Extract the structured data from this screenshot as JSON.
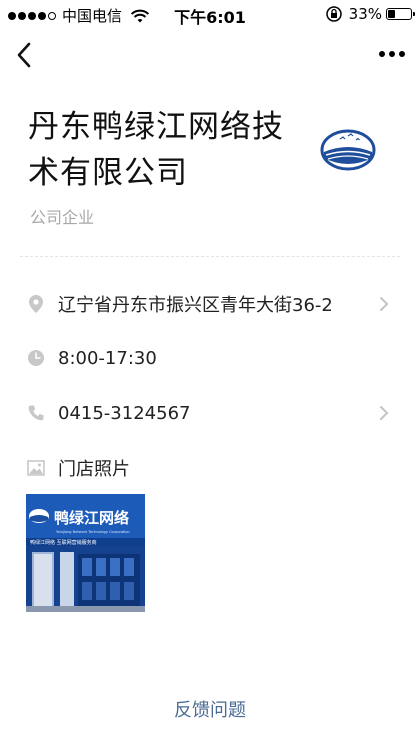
{
  "status_bar": {
    "carrier": "中国电信",
    "time": "下午6:01",
    "battery_percent_label": "33%",
    "battery_level": 0.33,
    "signal_strength": 4
  },
  "nav": {
    "back_icon": "chevron-left-icon",
    "more_icon": "more-dots-icon"
  },
  "header": {
    "company_name": "丹东鸭绿江网络技术有限公司",
    "category": "公司企业",
    "logo_icon": "company-logo"
  },
  "info": {
    "address": {
      "icon": "location-pin-icon",
      "text": "辽宁省丹东市振兴区青年大街36-2",
      "has_chevron": true
    },
    "hours": {
      "icon": "clock-icon",
      "text": "8:00-17:30",
      "has_chevron": false
    },
    "phone": {
      "icon": "phone-icon",
      "text": "0415-3124567",
      "has_chevron": true
    },
    "photos": {
      "icon": "image-icon",
      "text": "门店照片"
    }
  },
  "store_photo": {
    "sign_text": "鸭绿江网络",
    "sign_subtext": "Yalujiang Network Technology Corporation",
    "lower_text": "鸭绿江网络 互联网营销服务商"
  },
  "footer": {
    "feedback_label": "反馈问题"
  },
  "colors": {
    "title": "#111111",
    "muted": "#a8a8a8",
    "icon": "#c8c8c8",
    "link": "#4a6b93",
    "sign_blue": "#1a4fa0"
  }
}
